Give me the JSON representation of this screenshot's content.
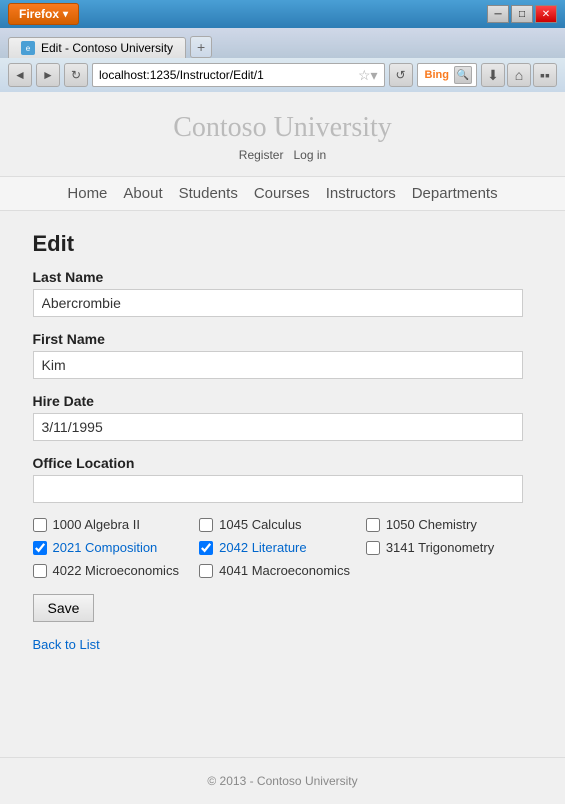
{
  "browser": {
    "firefox_label": "Firefox",
    "tab_title": "Edit - Contoso University",
    "new_tab_symbol": "+",
    "address_url": "localhost:1235/Instructor/Edit/1",
    "search_engine": "Bing",
    "back_symbol": "◄",
    "forward_symbol": "►",
    "refresh_symbol": "↻",
    "download_symbol": "⬇",
    "home_symbol": "⌂",
    "bookmark_symbol": "★",
    "minimize_symbol": "─",
    "maximize_symbol": "□",
    "close_symbol": "✕"
  },
  "site": {
    "title": "Contoso University",
    "auth_register": "Register",
    "auth_login": "Log in",
    "nav": [
      "Home",
      "About",
      "Students",
      "Courses",
      "Instructors",
      "Departments"
    ],
    "footer": "© 2013 - Contoso University"
  },
  "page": {
    "heading": "Edit",
    "last_name_label": "Last Name",
    "last_name_value": "Abercrombie",
    "first_name_label": "First Name",
    "first_name_value": "Kim",
    "hire_date_label": "Hire Date",
    "hire_date_value": "3/11/1995",
    "office_location_label": "Office Location",
    "office_location_value": "",
    "save_button": "Save",
    "back_link": "Back to List"
  },
  "courses": [
    {
      "id": "1000",
      "name": "Algebra II",
      "checked": false
    },
    {
      "id": "1045",
      "name": "Calculus",
      "checked": false
    },
    {
      "id": "1050",
      "name": "Chemistry",
      "checked": false
    },
    {
      "id": "2021",
      "name": "Composition",
      "checked": true
    },
    {
      "id": "2042",
      "name": "Literature",
      "checked": true
    },
    {
      "id": "3141",
      "name": "Trigonometry",
      "checked": false
    },
    {
      "id": "4022",
      "name": "Microeconomics",
      "checked": false
    },
    {
      "id": "4041",
      "name": "Macroeconomics",
      "checked": false
    }
  ]
}
